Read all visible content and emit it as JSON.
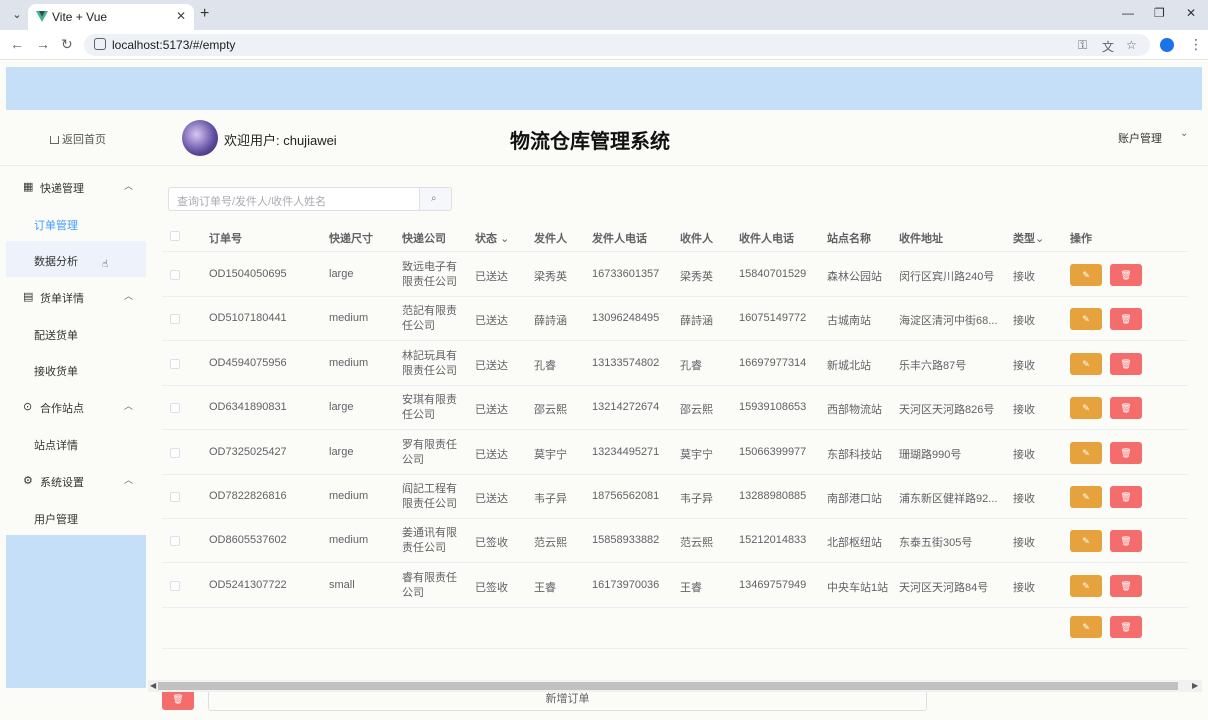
{
  "browser": {
    "tab_title": "Vite + Vue",
    "url": "localhost:5173/#/empty"
  },
  "header": {
    "back_home": "返回首页",
    "welcome": "欢迎用户: chujiawei",
    "system_title": "物流仓库管理系统",
    "account": "账户管理"
  },
  "sidebar": {
    "groups": [
      {
        "label": "快递管理",
        "icon": "grid-icon",
        "items": [
          "订单管理",
          "数据分析"
        ]
      },
      {
        "label": "货单详情",
        "icon": "document-icon",
        "items": [
          "配送货单",
          "接收货单"
        ]
      },
      {
        "label": "合作站点",
        "icon": "location-icon",
        "items": [
          "站点详情"
        ]
      },
      {
        "label": "系统设置",
        "icon": "gear-icon",
        "items": [
          "用户管理"
        ]
      }
    ],
    "active_item": "订单管理",
    "hovered_item": "数据分析"
  },
  "search": {
    "placeholder": "查询订单号/发件人/收件人姓名"
  },
  "table": {
    "columns": [
      "订单号",
      "快递尺寸",
      "快递公司",
      "状态",
      "发件人",
      "发件人电话",
      "收件人",
      "收件人电话",
      "站点名称",
      "收件地址",
      "类型",
      "操作"
    ],
    "rows": [
      {
        "order": "OD1504050695",
        "size": "large",
        "company": "致远电子有限责任公司",
        "status": "已送达",
        "sender": "梁秀英",
        "sender_phone": "16733601357",
        "receiver": "梁秀英",
        "receiver_phone": "15840701529",
        "station": "森林公园站",
        "address": "闵行区宾川路240号",
        "type": "接收"
      },
      {
        "order": "OD5107180441",
        "size": "medium",
        "company": "范記有限责任公司",
        "status": "已送达",
        "sender": "薛詩涵",
        "sender_phone": "13096248495",
        "receiver": "薛詩涵",
        "receiver_phone": "16075149772",
        "station": "古城南站",
        "address": "海淀区清河中街68...",
        "type": "接收"
      },
      {
        "order": "OD4594075956",
        "size": "medium",
        "company": "林記玩具有限责任公司",
        "status": "已送达",
        "sender": "孔睿",
        "sender_phone": "13133574802",
        "receiver": "孔睿",
        "receiver_phone": "16697977314",
        "station": "新城北站",
        "address": "乐丰六路87号",
        "type": "接收"
      },
      {
        "order": "OD6341890831",
        "size": "large",
        "company": "安琪有限责任公司",
        "status": "已送达",
        "sender": "邵云熙",
        "sender_phone": "13214272674",
        "receiver": "邵云熙",
        "receiver_phone": "15939108653",
        "station": "西部物流站",
        "address": "天河区天河路826号",
        "type": "接收"
      },
      {
        "order": "OD7325025427",
        "size": "large",
        "company": "罗有限责任公司",
        "status": "已送达",
        "sender": "莫宇宁",
        "sender_phone": "13234495271",
        "receiver": "莫宇宁",
        "receiver_phone": "15066399977",
        "station": "东部科技站",
        "address": "珊瑚路990号",
        "type": "接收"
      },
      {
        "order": "OD7822826816",
        "size": "medium",
        "company": "阎記工程有限责任公司",
        "status": "已送达",
        "sender": "韦子异",
        "sender_phone": "18756562081",
        "receiver": "韦子异",
        "receiver_phone": "13288980885",
        "station": "南部港口站",
        "address": "浦东新区健祥路92...",
        "type": "接收"
      },
      {
        "order": "OD8605537602",
        "size": "medium",
        "company": "姜通讯有限责任公司",
        "status": "已签收",
        "sender": "范云熙",
        "sender_phone": "15858933882",
        "receiver": "范云熙",
        "receiver_phone": "15212014833",
        "station": "北部枢纽站",
        "address": "东泰五街305号",
        "type": "接收"
      },
      {
        "order": "OD5241307722",
        "size": "small",
        "company": "睿有限责任公司",
        "status": "已签收",
        "sender": "王睿",
        "sender_phone": "16173970036",
        "receiver": "王睿",
        "receiver_phone": "13469757949",
        "station": "中央车站1站",
        "address": "天河区天河路84号",
        "type": "接收"
      }
    ]
  },
  "footer": {
    "add_order": "新增订单"
  },
  "colors": {
    "primary": "#409eff",
    "warning": "#e6a23c",
    "danger": "#f56c6c",
    "banner": "#c6dff8"
  }
}
